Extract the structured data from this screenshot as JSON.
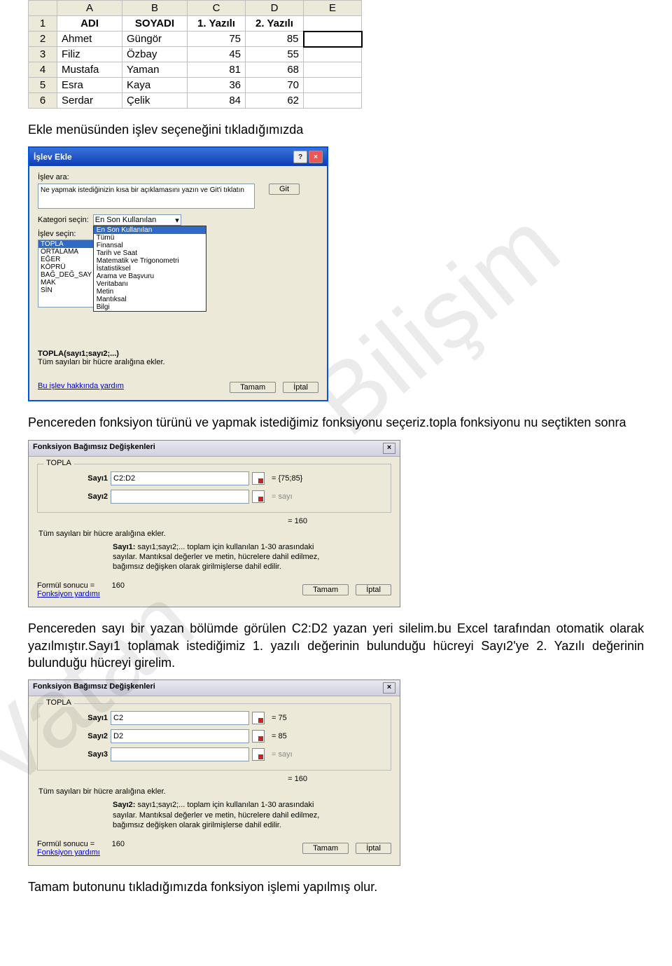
{
  "excel": {
    "col_headers": [
      "",
      "A",
      "B",
      "C",
      "D",
      "E"
    ],
    "rows": [
      {
        "n": "1",
        "cells": [
          "ADI",
          "SOYADI",
          "1. Yazılı",
          "2. Yazılı",
          ""
        ],
        "bold": true
      },
      {
        "n": "2",
        "cells": [
          "Ahmet",
          "Güngör",
          "75",
          "85",
          ""
        ],
        "active_e": true
      },
      {
        "n": "3",
        "cells": [
          "Filiz",
          "Özbay",
          "45",
          "55",
          ""
        ]
      },
      {
        "n": "4",
        "cells": [
          "Mustafa",
          "Yaman",
          "81",
          "68",
          ""
        ]
      },
      {
        "n": "5",
        "cells": [
          "Esra",
          "Kaya",
          "36",
          "70",
          ""
        ]
      },
      {
        "n": "6",
        "cells": [
          "Serdar",
          "Çelik",
          "84",
          "62",
          ""
        ]
      }
    ]
  },
  "text1": "Ekle menüsünden işlev seçeneğini tıkladığımızda",
  "text2": "Pencereden fonksiyon türünü ve yapmak istediğimiz fonksiyonu seçeriz.topla fonksiyonu nu seçtikten sonra",
  "text3": "Pencereden sayı bir yazan bölümde görülen C2:D2  yazan yeri silelim.bu Excel tarafından otomatik olarak yazılmıştır.Sayı1   toplamak istediğimiz 1. yazılı değerinin bulunduğu hücreyi Sayı2'ye 2. Yazılı değerinin bulunduğu hücreyi girelim.",
  "text4": "Tamam butonunu tıkladığımızda fonksiyon işlemi yapılmış olur.",
  "dialog1": {
    "title": "İşlev Ekle",
    "search_label": "İşlev ara:",
    "search_value": "Ne yapmak istediğinizin kısa bir açıklamasını yazın ve Git'i tıklatın",
    "go": "Git",
    "cat_label": "Kategori seçin:",
    "cat_value": "En Son Kullanılan",
    "cat_options": [
      "En Son Kullanılan",
      "Tümü",
      "Finansal",
      "Tarih ve Saat",
      "Matematik ve Trigonometri",
      "İstatistiksel",
      "Arama ve Başvuru",
      "Veritabanı",
      "Metin",
      "Mantıksal",
      "Bilgi"
    ],
    "func_label": "İşlev seçin:",
    "functions": [
      "TOPLA",
      "ORTALAMA",
      "EĞER",
      "KÖPRÜ",
      "BAĞ_DEĞ_SAY",
      "MAK",
      "SİN"
    ],
    "sig": "TOPLA(sayı1;sayı2;...)",
    "desc": "Tüm sayıları bir hücre aralığına ekler.",
    "help": "Bu işlev hakkında yardım",
    "ok": "Tamam",
    "cancel": "İptal"
  },
  "dialog2": {
    "title": "Fonksiyon Bağımsız Değişkenleri",
    "group": "TOPLA",
    "args": [
      {
        "label": "Sayı1",
        "value": "C2:D2",
        "result": "= {75;85}"
      },
      {
        "label": "Sayı2",
        "value": "",
        "result": "= sayı",
        "gray": true
      }
    ],
    "total": "= 160",
    "desc": "Tüm sayıları bir hücre aralığına ekler.",
    "argdesc_label": "Sayı1:",
    "argdesc": "sayı1;sayı2;... toplam için kullanılan 1-30 arasındaki sayılar. Mantıksal değerler ve metin, hücrelere dahil edilmez, bağımsız değişken olarak girilmişlerse dahil edilir.",
    "formula_label": "Formül sonucu =",
    "formula_result": "160",
    "help": "Fonksiyon yardımı",
    "ok": "Tamam",
    "cancel": "İptal"
  },
  "dialog3": {
    "title": "Fonksiyon Bağımsız Değişkenleri",
    "group": "TOPLA",
    "args": [
      {
        "label": "Sayı1",
        "value": "C2",
        "result": "= 75"
      },
      {
        "label": "Sayı2",
        "value": "D2",
        "result": "= 85"
      },
      {
        "label": "Sayı3",
        "value": "",
        "result": "= sayı",
        "gray": true
      }
    ],
    "total": "= 160",
    "desc": "Tüm sayıları bir hücre aralığına ekler.",
    "argdesc_label": "Sayı2:",
    "argdesc": "sayı1;sayı2;... toplam için kullanılan 1-30 arasındaki sayılar. Mantıksal değerler ve metin, hücrelere dahil edilmez, bağımsız değişken olarak girilmişlerse dahil edilir.",
    "formula_label": "Formül sonucu =",
    "formula_result": "160",
    "help": "Fonksiyon yardımı",
    "ok": "Tamam",
    "cancel": "İptal"
  }
}
